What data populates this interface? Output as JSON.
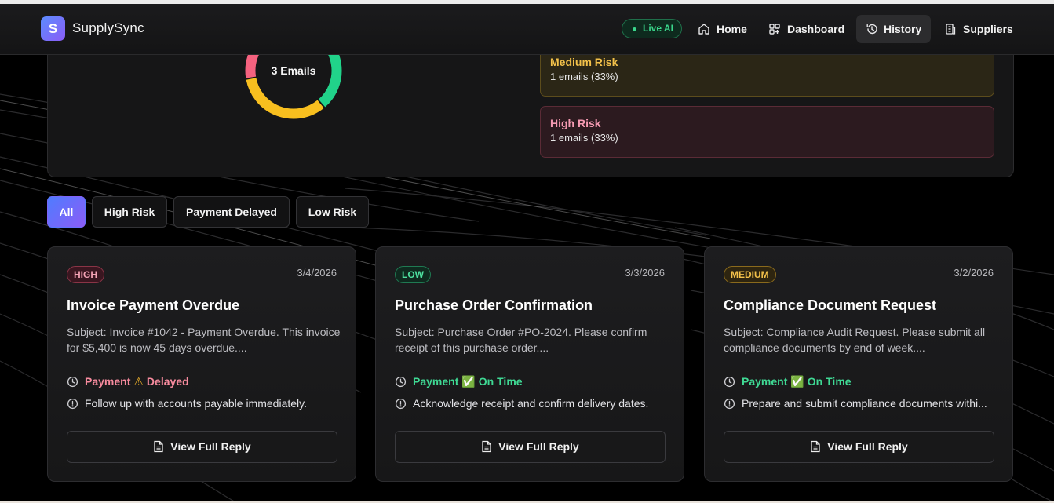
{
  "app": {
    "logo_letter": "S",
    "name": "SupplySync"
  },
  "nav": {
    "live_label": "Live AI",
    "items": [
      {
        "label": "Home",
        "icon": "home-icon"
      },
      {
        "label": "Dashboard",
        "icon": "dashboard-icon"
      },
      {
        "label": "History",
        "icon": "history-icon",
        "active": true
      },
      {
        "label": "Suppliers",
        "icon": "building-icon"
      }
    ]
  },
  "summary": {
    "donut_label": "3 Emails",
    "donut_segments": [
      {
        "risk": "Low",
        "share": 0.3333,
        "color": "#21d38a"
      },
      {
        "risk": "Medium",
        "share": 0.3333,
        "color": "#f8bf1f"
      },
      {
        "risk": "High",
        "share": 0.3333,
        "color": "#f5627f"
      }
    ],
    "risks": [
      {
        "title": "Medium Risk",
        "count": "1 emails (33%)"
      },
      {
        "title": "High Risk",
        "count": "1 emails (33%)"
      }
    ]
  },
  "filters": [
    {
      "label": "All",
      "active": true
    },
    {
      "label": "High Risk"
    },
    {
      "label": "Payment Delayed"
    },
    {
      "label": "Low Risk"
    }
  ],
  "cards": [
    {
      "badge": "HIGH",
      "date": "3/4/2026",
      "title": "Invoice Payment Overdue",
      "description": "Subject: Invoice #1042 - Payment Overdue. This invoice for $5,400 is now 45 days overdue....",
      "payment_label": "Payment",
      "status_glyph": "⚠",
      "status_text": "Delayed",
      "action": "Follow up with accounts payable immediately.",
      "button": "View Full Reply"
    },
    {
      "badge": "LOW",
      "date": "3/3/2026",
      "title": "Purchase Order Confirmation",
      "description": "Subject: Purchase Order #PO-2024. Please confirm receipt of this purchase order....",
      "payment_label": "Payment",
      "status_glyph": "✅",
      "status_text": "On Time",
      "action": "Acknowledge receipt and confirm delivery dates.",
      "button": "View Full Reply"
    },
    {
      "badge": "MEDIUM",
      "date": "3/2/2026",
      "title": "Compliance Document Request",
      "description": "Subject: Compliance Audit Request. Please submit all compliance documents by end of week....",
      "payment_label": "Payment",
      "status_glyph": "✅",
      "status_text": "On Time",
      "action": "Prepare and submit compliance documents withi...",
      "button": "View Full Reply"
    }
  ]
}
